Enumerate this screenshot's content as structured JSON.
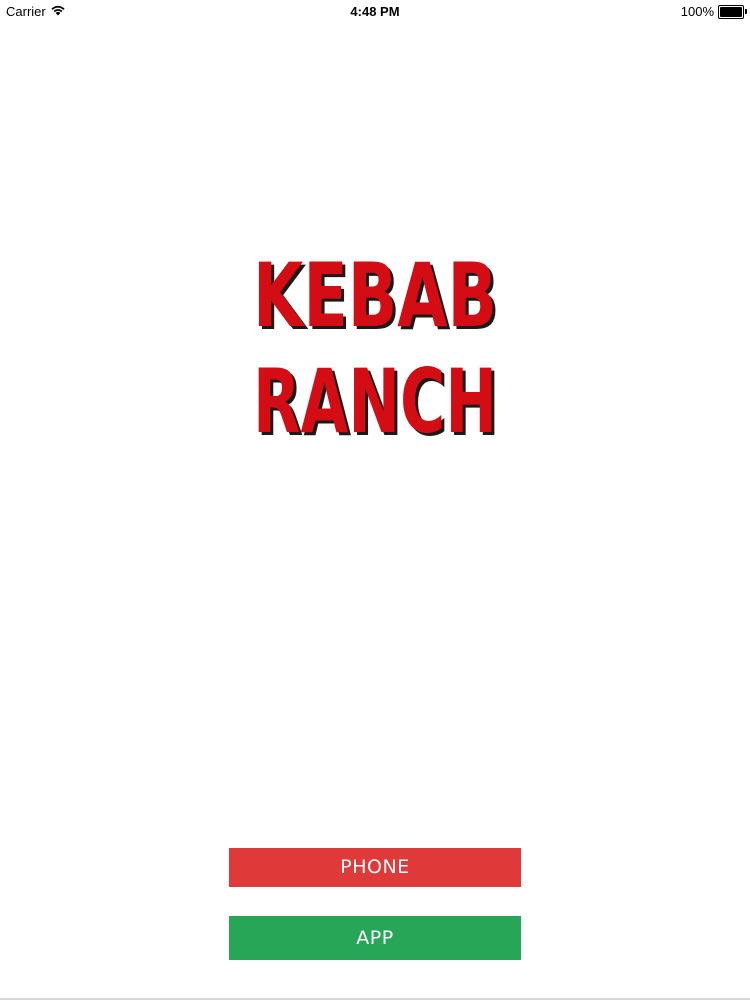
{
  "status_bar": {
    "carrier": "Carrier",
    "time": "4:48 PM",
    "battery_percent": "100%",
    "battery_level": 1.0
  },
  "logo": {
    "line1": "KEBAB",
    "line2": "RANCH",
    "color": "#d40d14",
    "shadow_color": "#1a1a1a"
  },
  "buttons": {
    "phone_label": "PHONE",
    "phone_color": "#e0393a",
    "app_label": "APP",
    "app_color": "#27a657"
  },
  "icons": {
    "wifi": "wifi-icon",
    "battery": "battery-icon"
  }
}
